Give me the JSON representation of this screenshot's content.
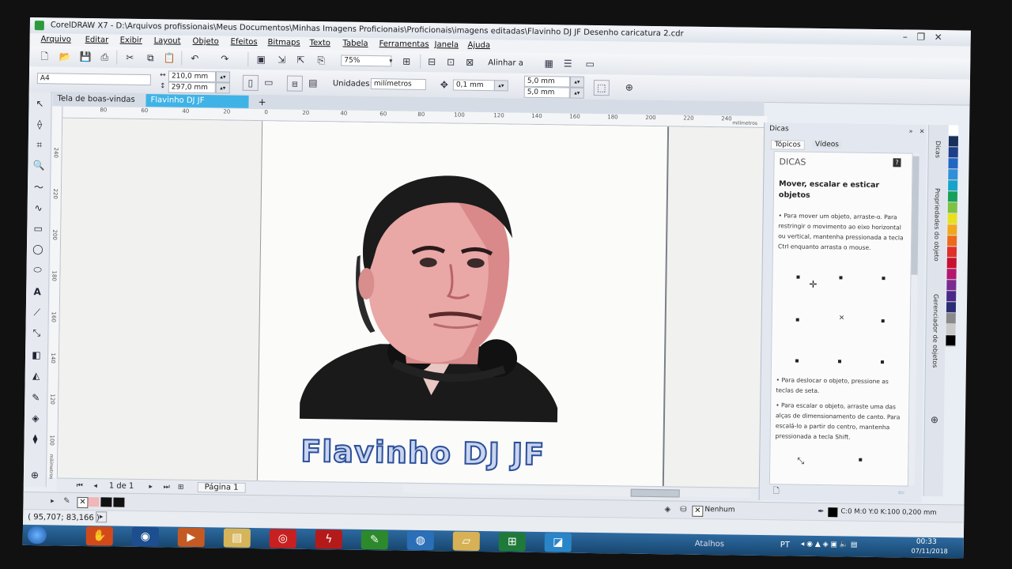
{
  "window": {
    "title": "CorelDRAW X7 - D:\\Arquivos profissionais\\Meus Documentos\\Minhas Imagens Proficionais\\Proficionais\\imagens editadas\\Flavinho DJ JF Desenho caricatura 2.cdr"
  },
  "menu": [
    "Arquivo",
    "Editar",
    "Exibir",
    "Layout",
    "Objeto",
    "Efeitos",
    "Bitmaps",
    "Texto",
    "Tabela",
    "Ferramentas",
    "Janela",
    "Ajuda"
  ],
  "toolbar": {
    "zoom": "75%",
    "align": "Alinhar a"
  },
  "property_bar": {
    "page_size": "A4",
    "width": "210,0 mm",
    "height": "297,0 mm",
    "units_label": "Unidades:",
    "units_value": "milímetros",
    "nudge": "0,1 mm",
    "dup_x": "5,0 mm",
    "dup_y": "5,0 mm"
  },
  "doc_tabs": [
    "Tela de boas-vindas",
    "Flavinho DJ JF Desenh..."
  ],
  "ruler": {
    "h_ticks": [
      "80",
      "60",
      "40",
      "20",
      "0",
      "20",
      "40",
      "60",
      "80",
      "100",
      "120",
      "140",
      "160",
      "180",
      "200",
      "220",
      "240"
    ],
    "h_unit": "milímetros",
    "v_ticks": [
      "240",
      "220",
      "200",
      "180",
      "160",
      "140",
      "120",
      "100"
    ],
    "v_unit": "milímetros"
  },
  "artwork": {
    "logo_text": "Flavinho DJ JF"
  },
  "page_nav": {
    "count": "1 de 1",
    "page_tab": "Página 1"
  },
  "status": {
    "coords": "( 95,707; 83,166 )",
    "fill": "Nenhum",
    "outline": "C:0 M:0 Y:0 K:100  0,200 mm"
  },
  "docker": {
    "title": "Dicas",
    "tabs": [
      "Tópicos",
      "Vídeos"
    ],
    "heading": "DICAS",
    "subheading": "Mover, escalar e esticar objetos",
    "p1": "• Para mover um objeto, arraste-o. Para restringir o movimento ao eixo horizontal ou vertical, mantenha pressionada a tecla Ctrl enquanto arrasta o mouse.",
    "p2": "• Para deslocar o objeto, pressione as teclas de seta.",
    "p3": "• Para escalar o objeto, arraste uma das alças de dimensionamento de canto. Para escalá-lo a partir do centro, mantenha pressionada a tecla Shift."
  },
  "side_labels": [
    "Dicas",
    "Propriedades do objeto",
    "Gerenciador de objetos"
  ],
  "palette": [
    "#ffffff",
    "#1a2f5c",
    "#1d3f8a",
    "#2266c4",
    "#2f8fd9",
    "#17a3c7",
    "#18a05a",
    "#7dc242",
    "#e8e020",
    "#f2a81d",
    "#ec6a1c",
    "#e0302a",
    "#c8102e",
    "#b5176e",
    "#7b2b8f",
    "#4a2a87",
    "#2b2e74",
    "#8a8a8a",
    "#c9c9c9",
    "#000000"
  ],
  "taskbar": {
    "label": "Atalhos",
    "lang": "PT",
    "time": "00:33",
    "date": "07/11/2018"
  }
}
